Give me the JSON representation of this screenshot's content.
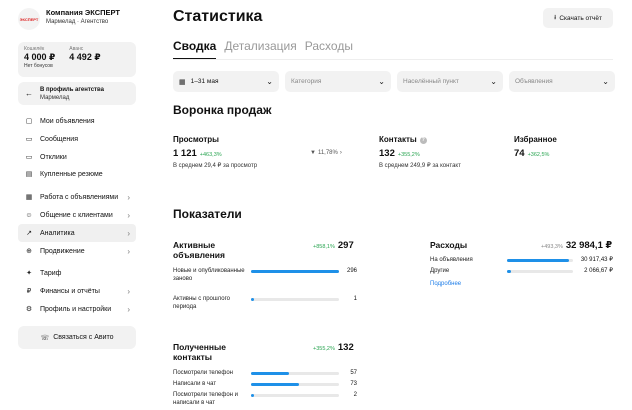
{
  "sidebar": {
    "company_logo_text": "ЭКСПЕРТ",
    "company_name": "Компания ЭКСПЕРТ",
    "company_sub": "Мармелад · Агентство",
    "wallet": {
      "label": "Кошелёк",
      "value": "4 000 ₽",
      "bonus": "Нет бонусов",
      "advance_label": "Аванс",
      "advance_value": "4 492 ₽"
    },
    "agency_profile": {
      "title": "В профиль агентства",
      "sub": "Мармелад"
    },
    "items": [
      {
        "label": "Мои объявления",
        "icon": "ads-icon"
      },
      {
        "label": "Сообщения",
        "icon": "message-icon"
      },
      {
        "label": "Отклики",
        "icon": "response-icon"
      },
      {
        "label": "Купленные резюме",
        "icon": "resume-icon"
      },
      {
        "label": "Работа с объявлениями",
        "icon": "work-icon"
      },
      {
        "label": "Общение с клиентами",
        "icon": "clients-icon"
      },
      {
        "label": "Аналитика",
        "icon": "analytics-icon"
      },
      {
        "label": "Продвижение",
        "icon": "promotion-icon"
      },
      {
        "label": "Тариф",
        "icon": "tariff-icon"
      },
      {
        "label": "Финансы и отчёты",
        "icon": "finance-icon"
      },
      {
        "label": "Профиль и настройки",
        "icon": "profile-icon"
      }
    ],
    "avito_button": "Связаться с Авито"
  },
  "header": {
    "title": "Статистика",
    "export": "Скачать отчёт"
  },
  "tabs": [
    {
      "label": "Сводка"
    },
    {
      "label": "Детализация"
    },
    {
      "label": "Расходы"
    }
  ],
  "filters": {
    "period": "1–31 мая",
    "category": "Категория",
    "city": "Населённый пункт",
    "ads": "Объявления"
  },
  "funnel": {
    "title": "Воронка продаж",
    "views": {
      "label": "Просмотры",
      "value": "1 121",
      "delta": "+463,3%",
      "sub": "В среднем 29,4 ₽ за просмотр"
    },
    "conversion": "11,78%",
    "contacts": {
      "label": "Контакты",
      "value": "132",
      "delta": "+355,2%",
      "sub": "В среднем 249,9 ₽ за контакт"
    },
    "favorites": {
      "label": "Избранное",
      "value": "74",
      "delta": "+362,5%"
    }
  },
  "indicators": {
    "title": "Показатели",
    "active": {
      "title": "Активные объявления",
      "delta": "+858,1%",
      "total": "297",
      "rows": [
        {
          "label": "Новые и опубликованные заново",
          "value": "296",
          "fraction": 0.997
        },
        {
          "label": "Активны с прошлого периода",
          "value": "1",
          "fraction": 0.01
        }
      ]
    },
    "expenses": {
      "title": "Расходы",
      "delta": "+493,3%",
      "total": "32 984,1 ₽",
      "rows": [
        {
          "label": "На объявления",
          "value": "30 917,43 ₽",
          "fraction": 0.94
        },
        {
          "label": "Другие",
          "value": "2 066,67 ₽",
          "fraction": 0.06
        }
      ],
      "link": "Подробнее"
    },
    "contacts": {
      "title": "Полученные контакты",
      "delta": "+355,2%",
      "total": "132",
      "rows": [
        {
          "label": "Посмотрели телефон",
          "value": "57",
          "fraction": 0.43
        },
        {
          "label": "Написали в чат",
          "value": "73",
          "fraction": 0.55
        },
        {
          "label": "Посмотрели телефон и написали в чат",
          "value": "2",
          "fraction": 0.02
        }
      ]
    }
  },
  "colors": {
    "accent_blue": "#1e90e8",
    "positive": "#2aa552",
    "logo_red": "#dd2222"
  }
}
